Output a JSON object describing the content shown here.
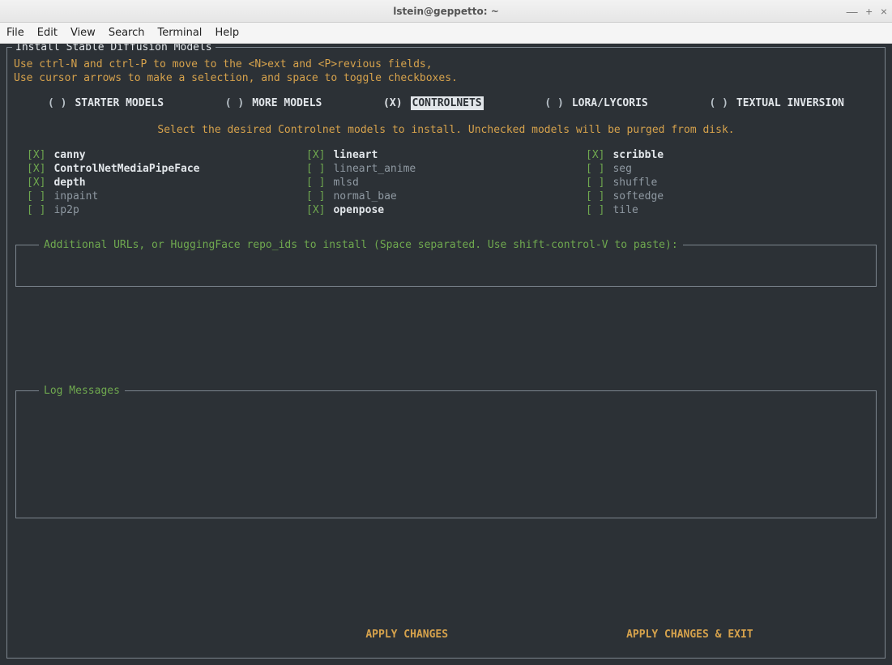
{
  "window": {
    "title": "lstein@geppetto: ~"
  },
  "menubar": [
    "File",
    "Edit",
    "View",
    "Search",
    "Terminal",
    "Help"
  ],
  "installer": {
    "title": "Install Stable Diffusion Models",
    "instructions_line1": "Use ctrl-N and ctrl-P to move to the <N>ext and <P>revious fields,",
    "instructions_line2": "Use cursor arrows to make a selection, and space to toggle checkboxes.",
    "tabs": [
      {
        "label": "STARTER MODELS",
        "selected": false
      },
      {
        "label": "MORE MODELS",
        "selected": false
      },
      {
        "label": "CONTROLNETS",
        "selected": true
      },
      {
        "label": "LORA/LYCORIS",
        "selected": false
      },
      {
        "label": "TEXTUAL INVERSION",
        "selected": false
      }
    ],
    "subtitle": "Select the desired Controlnet models to install. Unchecked models will be purged from disk.",
    "models_columns": [
      [
        {
          "label": "canny",
          "checked": true
        },
        {
          "label": "ControlNetMediaPipeFace",
          "checked": true
        },
        {
          "label": "depth",
          "checked": true
        },
        {
          "label": "inpaint",
          "checked": false
        },
        {
          "label": "ip2p",
          "checked": false
        }
      ],
      [
        {
          "label": "lineart",
          "checked": true
        },
        {
          "label": "lineart_anime",
          "checked": false
        },
        {
          "label": "mlsd",
          "checked": false
        },
        {
          "label": "normal_bae",
          "checked": false
        },
        {
          "label": "openpose",
          "checked": true
        }
      ],
      [
        {
          "label": "scribble",
          "checked": true
        },
        {
          "label": "seg",
          "checked": false
        },
        {
          "label": "shuffle",
          "checked": false
        },
        {
          "label": "softedge",
          "checked": false
        },
        {
          "label": "tile",
          "checked": false
        }
      ]
    ],
    "additional_urls_label": "Additional URLs, or HuggingFace repo_ids to install (Space separated. Use shift-control-V to paste):",
    "additional_urls_value": "",
    "log_messages_label": "Log Messages",
    "buttons": {
      "apply": "APPLY CHANGES",
      "apply_exit": "APPLY CHANGES & EXIT"
    }
  }
}
